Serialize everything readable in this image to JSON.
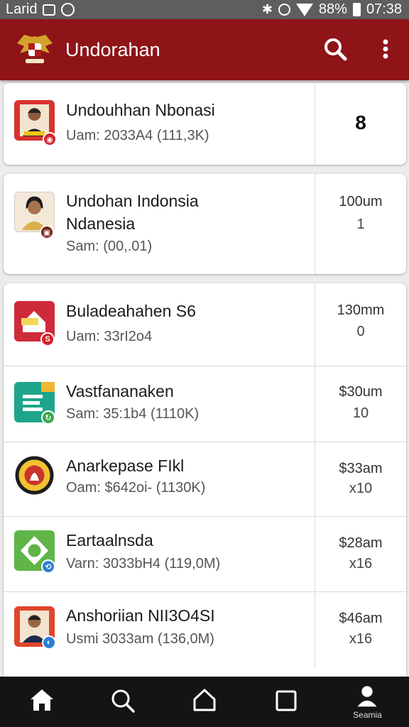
{
  "status_bar": {
    "carrier": "Larid",
    "battery": "88%",
    "time": "07:38"
  },
  "app_bar": {
    "title": "Undorahan"
  },
  "items": [
    {
      "title": "Undouhhan Nbonasi",
      "subtitle": "Uam: 2033A4 (111,3K)",
      "meta": "8",
      "meta2": "",
      "thumb_color": "#d8322d",
      "badge_color": "#d4222a"
    },
    {
      "title": "Undohan Indonsia",
      "title2": "Ndanesia",
      "subtitle": "Sam: (00,.01)",
      "meta": "100um",
      "meta2": "1",
      "thumb_color": "#f4e8d9",
      "badge_color": "#7b2214"
    },
    {
      "title": "Buladeahahen S6",
      "subtitle": "Uam: 33rI2o4",
      "meta": "130mm",
      "meta2": "0",
      "thumb_color": "#cf2a3a",
      "badge_color": "#d4222a"
    },
    {
      "title": "Vastfananaken",
      "subtitle": "Sam: 35:1b4 (1110K)",
      "meta": "$30um",
      "meta2": "10",
      "thumb_color": "#1da58a",
      "badge_color": "#3aa84a"
    },
    {
      "title": "Anarkepase FIkl",
      "subtitle": "Oam: $642oi- (1130K)",
      "meta": "$33am",
      "meta2": "x10",
      "thumb_color": "#f1c232",
      "badge_color": "#000000"
    },
    {
      "title": "Eartaalnsda",
      "subtitle": "Varn: 3033bH4 (119,0M)",
      "meta": "$28am",
      "meta2": "x16",
      "thumb_color": "#5fb548",
      "badge_color": "#2a7fd4"
    },
    {
      "title": "Anshoriian NII3O4SI",
      "subtitle": "Usmi 3033am (136,0M)",
      "meta": "$46am",
      "meta2": "x16",
      "thumb_color": "#e0452a",
      "badge_color": "#2a7fd4"
    }
  ],
  "bottom_nav": {
    "profile_label": "Seamia"
  },
  "colors": {
    "app_bar": "#8e1418",
    "status_bar": "#5e5e5e",
    "nav_bar": "#141414"
  }
}
